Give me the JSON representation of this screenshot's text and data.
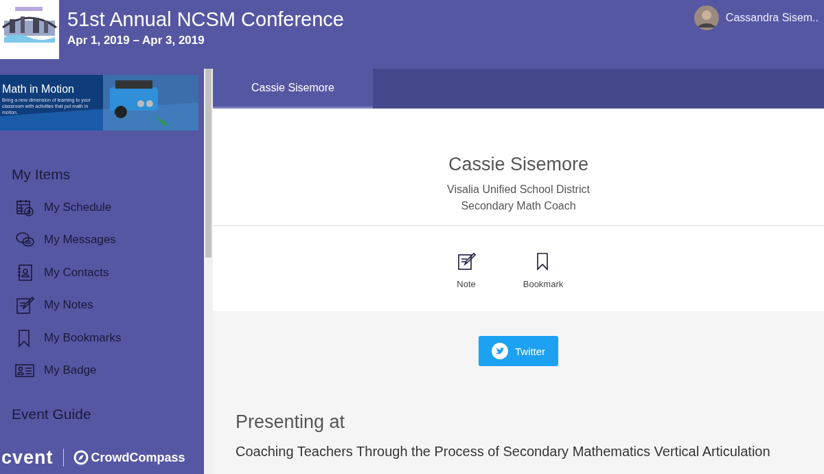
{
  "header": {
    "title": "51st Annual NCSM Conference",
    "dates": "Apr 1, 2019 – Apr 3, 2019",
    "user": "Cassandra Sisem.."
  },
  "banner": {
    "kind": "picture",
    "title": "Math in Motion",
    "subtitle": "Bring a new dimension of learning to your classroom with activities that put math in motion."
  },
  "sidebar": {
    "section": "My Items",
    "items": [
      {
        "label": "My Schedule",
        "kind": "schedule"
      },
      {
        "label": "My Messages",
        "kind": "messages"
      },
      {
        "label": "My Contacts",
        "kind": "contacts"
      },
      {
        "label": "My Notes",
        "kind": "notes"
      },
      {
        "label": "My Bookmarks",
        "kind": "bookmark"
      },
      {
        "label": "My Badge",
        "kind": "badge"
      }
    ],
    "section_2": "Event Guide",
    "footer": {
      "brand_1": "cvent",
      "brand_2": "CrowdCompass"
    }
  },
  "tabs": [
    {
      "label": "Cassie Sisemore",
      "selected": true
    }
  ],
  "profile": {
    "name": "Cassie Sisemore",
    "organization": "Visalia Unified School District",
    "role": "Secondary Math Coach"
  },
  "actions": [
    {
      "label": "Note",
      "kind": "notes"
    },
    {
      "label": "Bookmark",
      "kind": "bookmark"
    }
  ],
  "social": [
    {
      "label": "Twitter"
    }
  ],
  "presenting": {
    "heading": "Presenting at",
    "sessions": [
      "Coaching Teachers Through the Process of Secondary Mathematics Vertical Articulation"
    ]
  }
}
